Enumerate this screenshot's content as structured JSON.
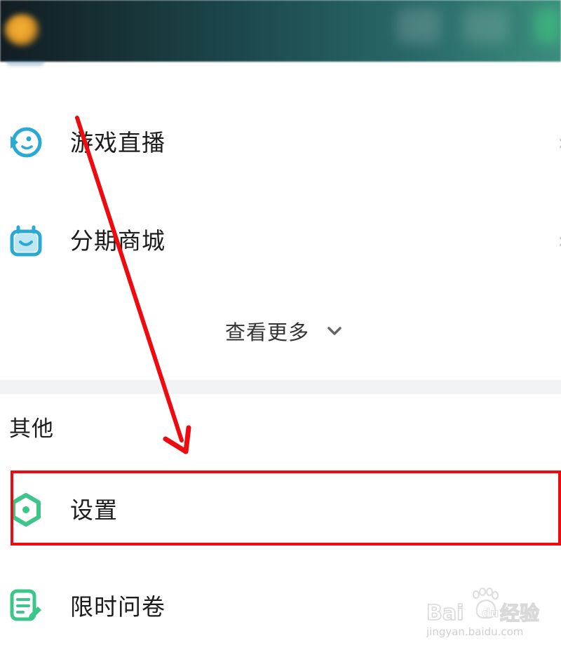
{
  "menu": {
    "items": [
      {
        "label": "游戏直播",
        "icon": "game-live-icon"
      },
      {
        "label": "分期商城",
        "icon": "installment-mall-icon"
      }
    ],
    "see_more_label": "查看更多"
  },
  "other_section": {
    "title": "其他",
    "items": [
      {
        "label": "设置",
        "icon": "settings-icon"
      },
      {
        "label": "限时问卷",
        "icon": "survey-icon"
      }
    ]
  },
  "watermark": {
    "brand": "Baidu经验",
    "url": "jingyan.baidu.com"
  },
  "colors": {
    "header_start": "#121d22",
    "header_end": "#3c8d7e",
    "icon_blue": "#2aa9d2",
    "icon_green": "#3cc68a",
    "annotation_red": "#ee0a0f",
    "divider": "#f2f3f5"
  }
}
